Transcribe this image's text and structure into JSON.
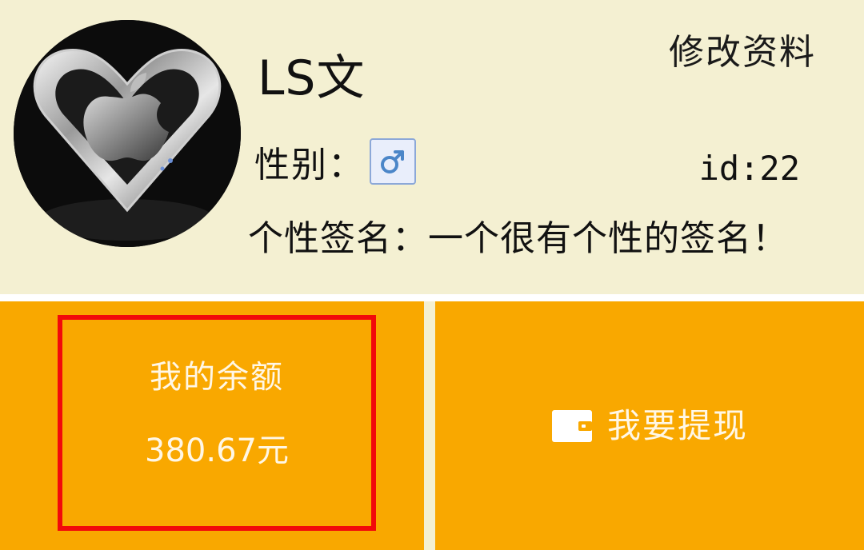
{
  "profile": {
    "username": "LS文",
    "edit_link": "修改资料",
    "gender_label": "性别：",
    "gender_icon": "male-symbol-icon",
    "user_id": "id:22",
    "signature": "个性签名：一个很有个性的签名！"
  },
  "wallet": {
    "balance_label": "我的余额",
    "balance_value": "380.67元",
    "withdraw_label": "我要提现",
    "withdraw_icon": "wallet-icon"
  },
  "colors": {
    "header_bg": "#f4f0d2",
    "tile_bg": "#f9a800",
    "highlight": "#f20a0a",
    "gender_icon": "#4b86c8"
  }
}
